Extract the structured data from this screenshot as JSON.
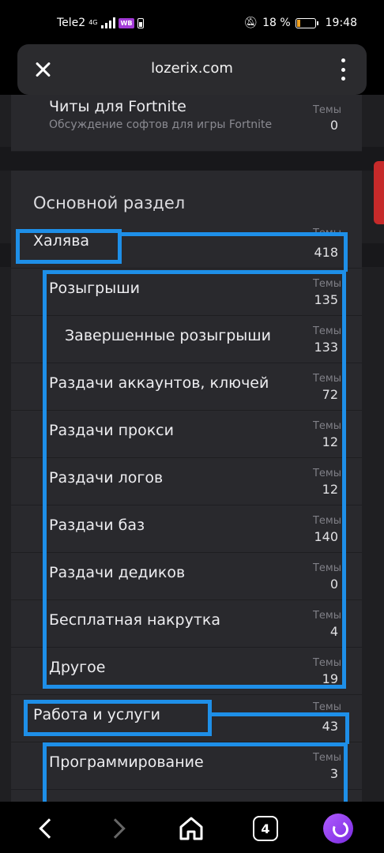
{
  "status": {
    "carrier": "Tele2",
    "network": "4G",
    "app_badge": "WB",
    "battery_percent": "18 %",
    "time": "19:48",
    "battery_level": 0.18
  },
  "browser": {
    "url": "lozerix.com",
    "tab_count": "4"
  },
  "forum": {
    "top_row": {
      "title": "Читы для Fortnite",
      "description": "Обсуждение софтов для игры Fortnite",
      "stat_label": "Темы",
      "stat_value": "0"
    },
    "section_title": "Основной раздел",
    "rows": [
      {
        "title": "Халява",
        "stat_label": "Темы",
        "stat_value": "418"
      },
      {
        "title": "Розыгрыши",
        "stat_label": "Темы",
        "stat_value": "135"
      },
      {
        "title": "Завершенные розыгрыши",
        "stat_label": "Темы",
        "stat_value": "133"
      },
      {
        "title": "Раздачи аккаунтов, ключей",
        "stat_label": "Темы",
        "stat_value": "72"
      },
      {
        "title": "Раздачи прокси",
        "stat_label": "Темы",
        "stat_value": "12"
      },
      {
        "title": "Раздачи логов",
        "stat_label": "Темы",
        "stat_value": "12"
      },
      {
        "title": "Раздачи баз",
        "stat_label": "Темы",
        "stat_value": "140"
      },
      {
        "title": "Раздачи дедиков",
        "stat_label": "Темы",
        "stat_value": "0"
      },
      {
        "title": "Бесплатная накрутка",
        "stat_label": "Темы",
        "stat_value": "4"
      },
      {
        "title": "Другое",
        "stat_label": "Темы",
        "stat_value": "19"
      },
      {
        "title": "Работа и услуги",
        "stat_label": "Темы",
        "stat_value": "43"
      },
      {
        "title": "Программирование",
        "stat_label": "Темы",
        "stat_value": "3"
      }
    ]
  },
  "colors": {
    "annotation": "#1e8fe8",
    "scrollbar": "#c62a2a",
    "assistant": "#9b4dff"
  }
}
